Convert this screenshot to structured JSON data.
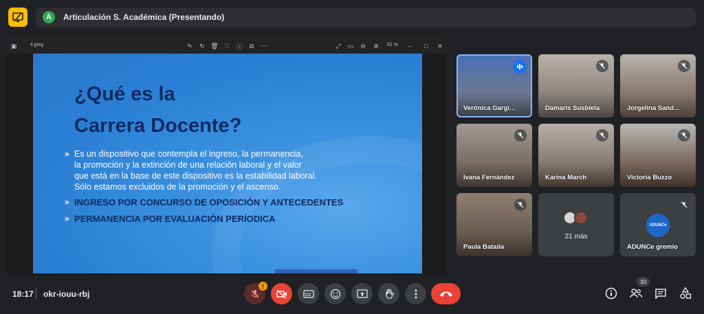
{
  "meeting": {
    "title": "Articulación S. Académica (Presentando)",
    "presenter_initial": "A",
    "time": "18:17",
    "code": "okr-iouu-rbj",
    "people_count": "30"
  },
  "viewer": {
    "filename": "4.jpeg",
    "zoom": "62 %"
  },
  "slide": {
    "title_line1": "¿Qué es la",
    "title_line2": "Carrera Docente?",
    "bullet1_lines": [
      "Es un dispositivo que contempla el ingreso, la permanencia,",
      "la promoción y la extinción de una relación laboral y el valor",
      "que está en la base de este dispositivo es la estabilidad laboral.",
      "Sólo estamos excluidos de la promoción y el ascenso."
    ],
    "bullet2": "INGRESO POR CONCURSO DE OPOSICIÓN Y ANTECEDENTES",
    "bullet3": "PERMANENCIA POR EVALUACIÓN PERÍODICA"
  },
  "participants": [
    {
      "name": "Verónica Gargi...",
      "muted": false,
      "speaking": true
    },
    {
      "name": "Damaris Susbiela",
      "muted": true
    },
    {
      "name": "Jorgelina Sand...",
      "muted": true
    },
    {
      "name": "Ivana Fernández",
      "muted": true
    },
    {
      "name": "Karina March",
      "muted": true
    },
    {
      "name": "Victoria Buzzo",
      "muted": true
    },
    {
      "name": "Paula Bataila",
      "muted": true
    }
  ],
  "overflow": {
    "label": "21 más"
  },
  "org_tile": {
    "name": "ADUNCe gremio",
    "avatar_text": "ADUNCe"
  },
  "controls": {
    "mic_warning": "!"
  },
  "colors": {
    "accent_yellow": "#fbbc04",
    "end_call_red": "#ea4335",
    "slide_blue": "#2a7fd4",
    "slide_title_navy": "#0f2a63"
  }
}
